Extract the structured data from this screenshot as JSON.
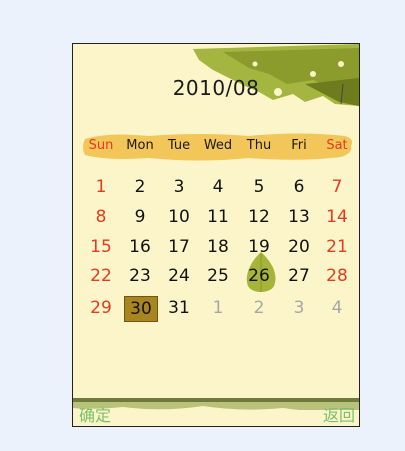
{
  "header": {
    "title": "2010/08"
  },
  "weekdays": [
    {
      "label": "Sun",
      "red": true
    },
    {
      "label": "Mon",
      "red": false
    },
    {
      "label": "Tue",
      "red": false
    },
    {
      "label": "Wed",
      "red": false
    },
    {
      "label": "Thu",
      "red": false
    },
    {
      "label": "Fri",
      "red": false
    },
    {
      "label": "Sat",
      "red": true
    }
  ],
  "weeks": [
    [
      "1",
      "2",
      "3",
      "4",
      "5",
      "6",
      "7"
    ],
    [
      "8",
      "9",
      "10",
      "11",
      "12",
      "13",
      "14"
    ],
    [
      "15",
      "16",
      "17",
      "18",
      "19",
      "20",
      "21"
    ],
    [
      "22",
      "23",
      "24",
      "25",
      "26",
      "27",
      "28"
    ],
    [
      "29",
      "30",
      "31",
      "1",
      "2",
      "3",
      "4"
    ]
  ],
  "selected_day": "30",
  "today_day": "26",
  "softkeys": {
    "left": "确定",
    "right": "返回"
  },
  "colors": {
    "weekend": "#e53a1f",
    "other_month": "#a6a6a6",
    "selected_bg": "#a8851f",
    "softkey": "#7cc06a"
  }
}
